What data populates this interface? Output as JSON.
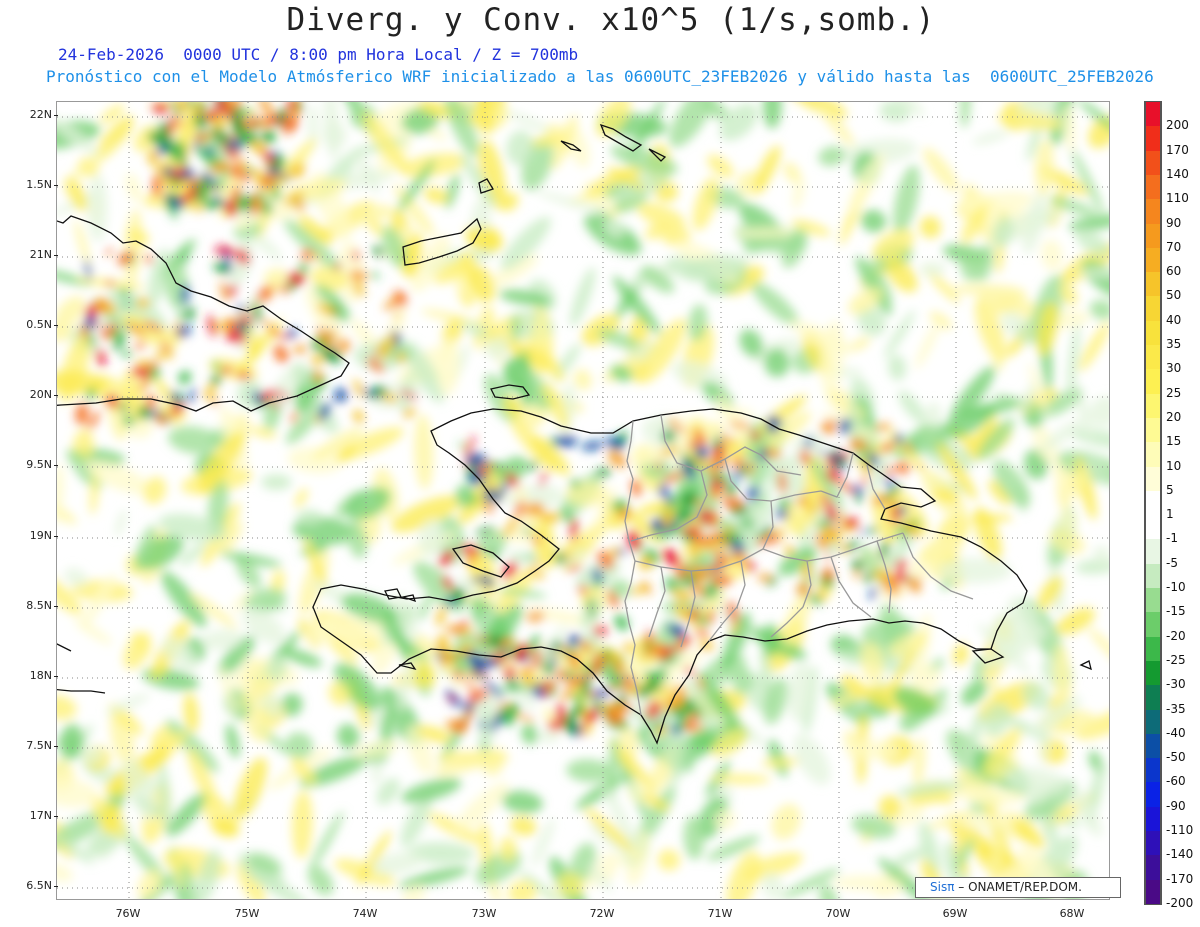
{
  "title": "Diverg. y Conv. x10^5 (1/s,somb.)",
  "subtitle_time": "24-Feb-2026  0000 UTC / 8:00 pm Hora Local / Z = 700mb",
  "subtitle_model": "Pronóstico con el Modelo Atmósferico WRF inicializado a las 0600UTC_23FEB2026 y válido hasta las  0600UTC_25FEB2026",
  "lat_labels": [
    "22N",
    "1.5N",
    "21N",
    "0.5N",
    "20N",
    "9.5N",
    "19N",
    "8.5N",
    "18N",
    "7.5N",
    "17N",
    "6.5N"
  ],
  "lon_labels": [
    "76W",
    "75W",
    "74W",
    "73W",
    "72W",
    "71W",
    "70W",
    "69W",
    "68W"
  ],
  "colorbar": {
    "labels": [
      "200",
      "170",
      "140",
      "110",
      "90",
      "70",
      "60",
      "50",
      "40",
      "35",
      "30",
      "25",
      "20",
      "15",
      "10",
      "5",
      "1",
      "-1",
      "-5",
      "-10",
      "-15",
      "-20",
      "-25",
      "-30",
      "-35",
      "-40",
      "-50",
      "-60",
      "-90",
      "-110",
      "-140",
      "-170",
      "-200"
    ],
    "colors": [
      "#e8102a",
      "#f02e1a",
      "#f2501a",
      "#f46e1e",
      "#f5861e",
      "#f59a1e",
      "#f6ad22",
      "#f6c42a",
      "#f7d634",
      "#f8e23c",
      "#fbe94a",
      "#fdf052",
      "#fdf670",
      "#fefa94",
      "#fefcb8",
      "#fffdd8",
      "#ffffff",
      "#ffffff",
      "#e8f6e4",
      "#c6ebc0",
      "#98dc90",
      "#6ccd6a",
      "#3cb84a",
      "#149a30",
      "#0e7e52",
      "#0d6b78",
      "#0c4fa6",
      "#0b36cc",
      "#0a22e6",
      "#1a14d8",
      "#2e10b8",
      "#3c0e9a",
      "#4a0a86"
    ]
  },
  "credit": {
    "brand": "Sisπ",
    "text": "– ONAMET/REP.DOM."
  },
  "map_features": {
    "field": "divergence-shading",
    "coastlines": [
      "cuba",
      "hispaniola",
      "turks-caicos",
      "bahamas",
      "isla-de-la-tortuga",
      "gonave",
      "saona",
      "inagua"
    ],
    "political": [
      "haiti-dr-border",
      "dr-provinces"
    ]
  }
}
